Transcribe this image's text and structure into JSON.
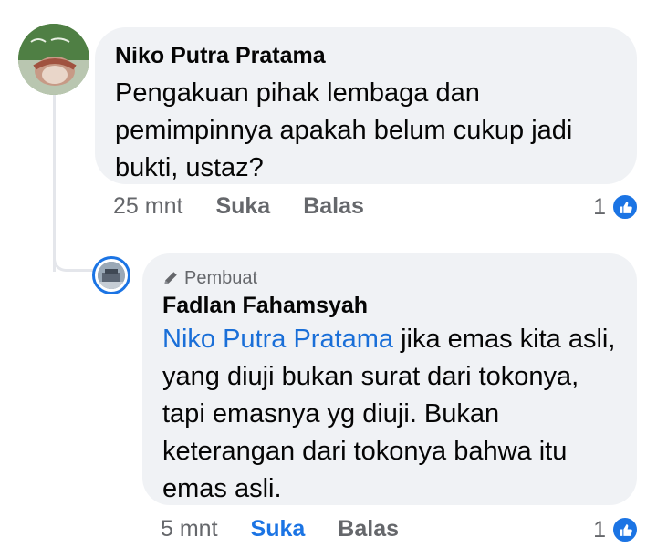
{
  "comment": {
    "author": "Niko Putra Pratama",
    "text": "Pengakuan pihak lembaga dan pemimpinnya apakah belum cukup jadi bukti, ustaz?",
    "time": "25 mnt",
    "like_label": "Suka",
    "reply_label": "Balas",
    "reaction_count": "1",
    "reaction_icon": "thumbs-up-icon"
  },
  "reply": {
    "badge_icon": "pencil-icon",
    "badge_label": "Pembuat",
    "author": "Fadlan Fahamsyah",
    "mention": "Niko Putra Pratama",
    "text": " jika emas kita asli, yang diuji bukan surat dari tokonya, tapi emasnya yg diuji. Bukan keterangan dari tokonya bahwa itu emas asli.",
    "time": "5 mnt",
    "like_label": "Suka",
    "reply_label": "Balas",
    "reaction_count": "1",
    "reaction_icon": "thumbs-up-icon"
  },
  "colors": {
    "bubble": "#f0f2f5",
    "accent": "#1b74e4",
    "mention": "#1a6fd8",
    "meta": "#65676b"
  }
}
